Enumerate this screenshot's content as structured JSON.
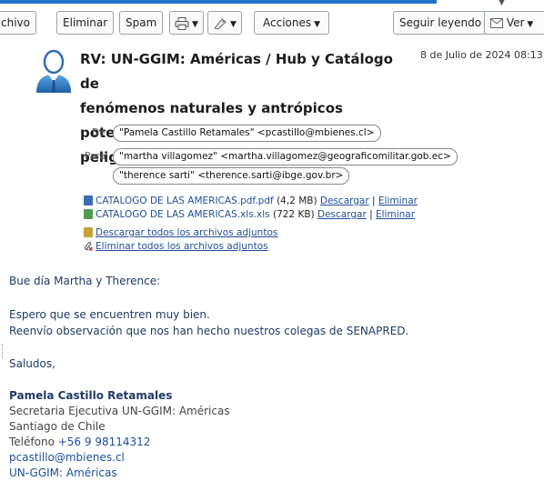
{
  "toolbar": {
    "archive_label": "chivo",
    "delete_label": "Eliminar",
    "spam_label": "Spam",
    "actions_label": "Acciones",
    "follow_label": "Seguir leyendo",
    "view_label": "Ver",
    "accent_color": "#1f73c9"
  },
  "message": {
    "subject_lines": [
      "RV: UN-GGIM: Américas / Hub y Catálogo de",
      "fenómenos naturales y antrópicos potencialmente",
      "peligrosos de las América"
    ],
    "date": "8 de Julio de 2024 08:13",
    "from_label": "De:",
    "from": "\"Pamela Castillo Retamales\" <pcastillo@mbienes.cl>",
    "to_label": "Para:",
    "to": [
      "\"martha villagomez\" <martha.villagomez@geograficomilitar.gob.ec>",
      "\"therence sarti\" <therence.sarti@ibge.gov.br>"
    ]
  },
  "attachments": {
    "files": [
      {
        "name": "CATALOGO DE LAS AMERICAS.pdf.pdf",
        "size": "(4,2 MB)",
        "download": "Descargar",
        "separator": "|",
        "delete": "Eliminar",
        "icon": "pdf-file-icon",
        "color": "#3a6db5"
      },
      {
        "name": "CATALOGO DE LAS AMERICAS.xls.xls",
        "size": "(722 KB)",
        "download": "Descargar",
        "separator": "|",
        "delete": "Eliminar",
        "icon": "spreadsheet-file-icon",
        "color": "#4f9a4f"
      }
    ],
    "download_all": "Descargar todos los archivos adjuntos",
    "delete_all": "Eliminar todos los archivos adjuntos"
  },
  "body": {
    "greeting": "Bue día Martha y Therence:",
    "line1": "Espero que se encuentren muy bien.",
    "line2": "Reenvío observación que nos han hecho nuestros colegas de SENAPRED.",
    "closing": "Saludos,"
  },
  "signature": {
    "name": "Pamela Castillo Retamales",
    "title": "Secretaria Ejecutiva UN-GGIM: Américas",
    "city": "Santiago de Chile",
    "phone_label": "Teléfono",
    "phone": "+56 9 98114312",
    "email": "pcastillo@mbienes.cl",
    "org": "UN-GGIM: Américas"
  }
}
